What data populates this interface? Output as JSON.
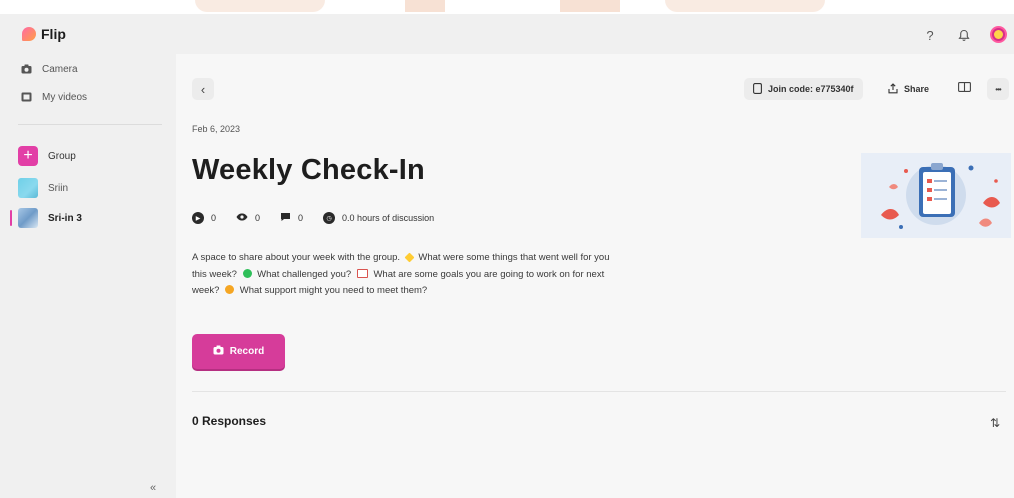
{
  "app": {
    "name": "Flip"
  },
  "header": {
    "help_glyph": "?",
    "icons": [
      "help-icon",
      "bell-icon",
      "avatar"
    ]
  },
  "sidebar": {
    "items": [
      {
        "label": "Camera",
        "icon": "camera-icon"
      },
      {
        "label": "My videos",
        "icon": "video-icon"
      }
    ],
    "groups": [
      {
        "label": "Group",
        "icon": "plus-icon"
      },
      {
        "label": "Sriin",
        "icon": "group-thumbnail"
      },
      {
        "label": "Sri-in 3",
        "icon": "group-thumbnail",
        "active": true
      }
    ],
    "collapse_glyph": "«"
  },
  "topic": {
    "back_glyph": "‹",
    "join_code_label": "Join code: e775340f",
    "share_label": "Share",
    "more_glyph": "•••",
    "date": "Feb 6, 2023",
    "title": "Weekly Check-In",
    "stats": {
      "videos": "0",
      "views": "0",
      "comments": "0",
      "discussion": "0.0 hours of discussion"
    },
    "description_parts": [
      "A space to share about your week with the group.",
      "What were some things that went well for you this week?",
      "What challenged you?",
      "What are some goals you are going to work on for next week?",
      "What support might you need to meet them?"
    ],
    "record_label": "Record",
    "responses_label": "0 Responses",
    "sort_glyph": "⇅"
  },
  "colors": {
    "accent": "#d63c9a",
    "sidebar_bg": "#f0f0f0",
    "main_bg": "#f7f7f7"
  }
}
